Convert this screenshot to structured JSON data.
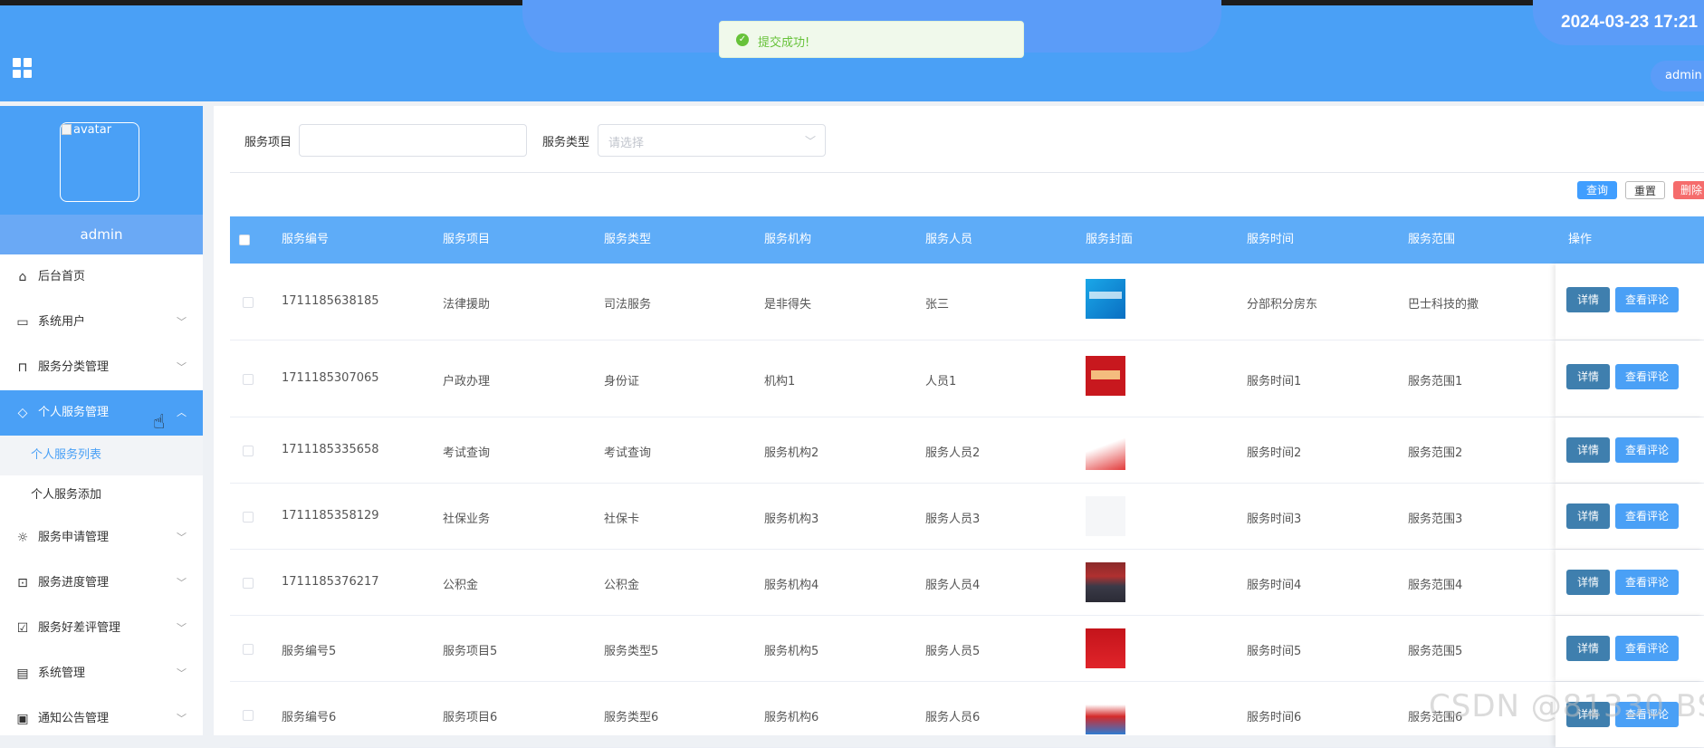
{
  "header": {
    "datetime": "2024-03-23 17:21",
    "user_menu": "admin"
  },
  "toast": {
    "message": "提交成功!"
  },
  "sidebar": {
    "avatar_alt": "avatar",
    "username": "admin",
    "menu": [
      {
        "label": "后台首页",
        "icon": "home-icon"
      },
      {
        "label": "系统用户",
        "icon": "monitor-icon"
      },
      {
        "label": "服务分类管理",
        "icon": "bookmark-icon"
      },
      {
        "label": "个人服务管理",
        "icon": "tag-icon"
      },
      {
        "label": "服务申请管理",
        "icon": "sun-icon"
      },
      {
        "label": "服务进度管理",
        "icon": "inbox-icon"
      },
      {
        "label": "服务好差评管理",
        "icon": "clipboard-check-icon"
      },
      {
        "label": "系统管理",
        "icon": "chat-icon"
      },
      {
        "label": "通知公告管理",
        "icon": "notice-icon"
      }
    ],
    "submenu": [
      {
        "label": "个人服务列表"
      },
      {
        "label": "个人服务添加"
      }
    ]
  },
  "search": {
    "item_label": "服务项目",
    "item_value": "",
    "type_label": "服务类型",
    "type_placeholder": "请选择"
  },
  "actions": {
    "query": "查询",
    "reset": "重置",
    "delete": "删除"
  },
  "table": {
    "columns": [
      "服务编号",
      "服务项目",
      "服务类型",
      "服务机构",
      "服务人员",
      "服务封面",
      "服务时间",
      "服务范围",
      "操作"
    ],
    "rows": [
      {
        "no": "1711185638185",
        "item": "法律援助",
        "type": "司法服务",
        "org": "是非得失",
        "staff": "张三",
        "cover": "thumb-blue",
        "time": "分部积分房东",
        "range": "巴士科技的撒"
      },
      {
        "no": "1711185307065",
        "item": "户政办理",
        "type": "身份证",
        "org": "机构1",
        "staff": "人员1",
        "cover": "thumb-red",
        "time": "服务时间1",
        "range": "服务范围1"
      },
      {
        "no": "1711185335658",
        "item": "考试查询",
        "type": "考试查询",
        "org": "服务机构2",
        "staff": "服务人员2",
        "cover": "thumb-white-red",
        "time": "服务时间2",
        "range": "服务范围2"
      },
      {
        "no": "1711185358129",
        "item": "社保业务",
        "type": "社保卡",
        "org": "服务机构3",
        "staff": "服务人员3",
        "cover": "thumb-blank",
        "time": "服务时间3",
        "range": "服务范围3"
      },
      {
        "no": "1711185376217",
        "item": "公积金",
        "type": "公积金",
        "org": "服务机构4",
        "staff": "服务人员4",
        "cover": "thumb-crowd",
        "time": "服务时间4",
        "range": "服务范围4"
      },
      {
        "no": "服务编号5",
        "item": "服务项目5",
        "type": "服务类型5",
        "org": "服务机构5",
        "staff": "服务人员5",
        "cover": "thumb-red2",
        "time": "服务时间5",
        "range": "服务范围5"
      },
      {
        "no": "服务编号6",
        "item": "服务项目6",
        "type": "服务类型6",
        "org": "服务机构6",
        "staff": "服务人员6",
        "cover": "thumb-poster",
        "time": "服务时间6",
        "range": "服务范围6"
      }
    ],
    "row_actions": {
      "detail": "详情",
      "review": "查看评论"
    }
  },
  "watermark": "CSDN @81330 BS",
  "colors": {
    "primary": "#4aa0f6",
    "header_row": "#5eacf8",
    "detail_btn": "#3f7fae",
    "danger": "#f56c6c",
    "success": "#67c23a"
  }
}
